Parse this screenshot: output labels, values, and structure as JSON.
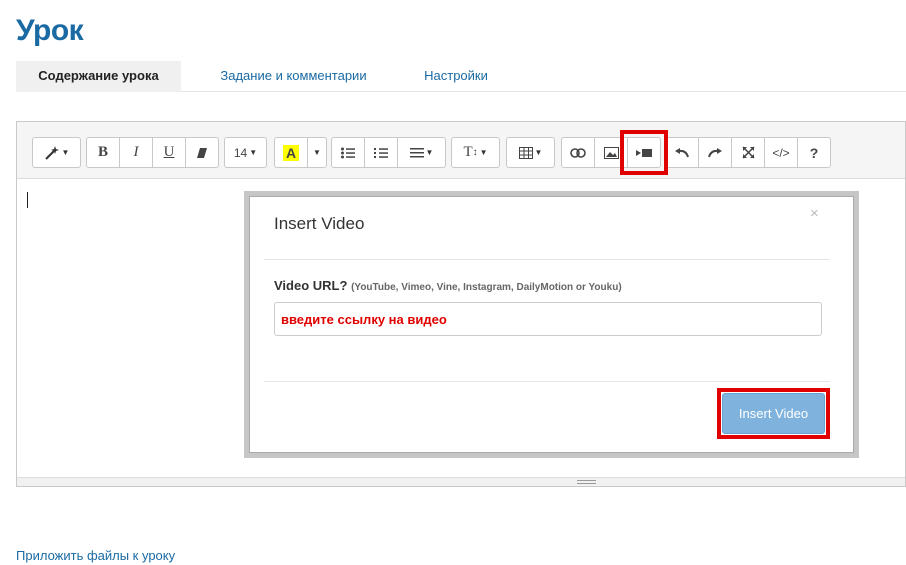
{
  "page": {
    "title": "Урок"
  },
  "tabs": [
    {
      "label": "Содержание урока",
      "active": true
    },
    {
      "label": "Задание и комментарии",
      "active": false
    },
    {
      "label": "Настройки",
      "active": false
    }
  ],
  "toolbar": {
    "style_icon": "magic-wand-icon",
    "bold": "B",
    "italic": "I",
    "underline": "U",
    "eraser_icon": "eraser-icon",
    "font_size": "14",
    "highlight_letter": "A",
    "highlight_color": "#ffff00",
    "ul_icon": "unordered-list-icon",
    "ol_icon": "ordered-list-icon",
    "align_icon": "align-icon",
    "line_height_label": "T",
    "table_icon": "table-icon",
    "link_icon": "link-icon",
    "picture_icon": "picture-icon",
    "video_icon": "video-icon",
    "undo_icon": "undo-icon",
    "redo_icon": "redo-icon",
    "fullscreen_icon": "fullscreen-icon",
    "code_label": "</>",
    "help_label": "?"
  },
  "modal": {
    "title": "Insert Video",
    "close": "×",
    "url_label": "Video URL?",
    "url_hint": "(YouTube, Vimeo, Vine, Instagram, DailyMotion or Youku)",
    "url_placeholder": "введите ссылку на видео",
    "insert_button": "Insert Video"
  },
  "footer": {
    "attach_link": "Приложить файлы к уроку"
  },
  "colors": {
    "brand": "#1a6aa3",
    "highlight": "#e00000",
    "button": "#7fb3dd"
  }
}
